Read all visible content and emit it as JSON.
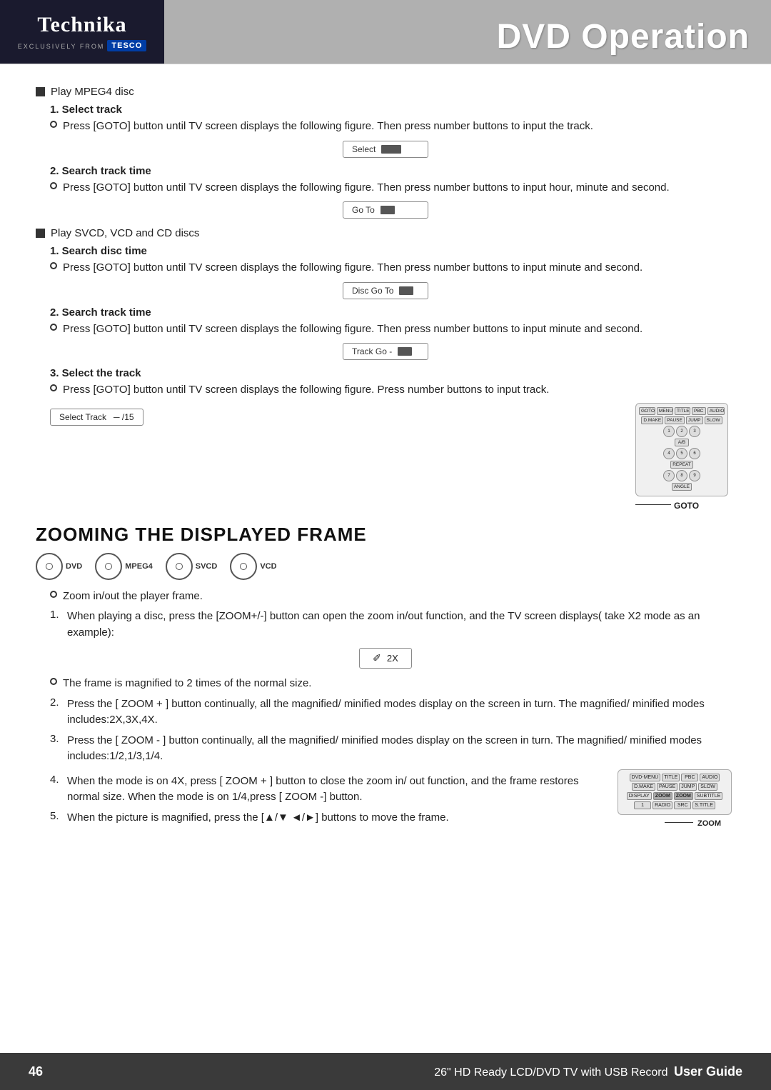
{
  "header": {
    "logo_main": "Technika",
    "logo_sub": "EXCLUSIVELY FROM",
    "tesco": "TESCO",
    "page_title": "DVD Operation"
  },
  "sections": {
    "play_mpeg4": "Play MPEG4 disc",
    "select_track": {
      "heading": "1. Select track",
      "bullet": "Press [GOTO] button until TV screen displays the following figure. Then press number buttons to input the track.",
      "mockup_label": "Select",
      "mockup_value": "■"
    },
    "search_track_time_1": {
      "heading": "2. Search track time",
      "bullet": "Press [GOTO] button until TV screen displays the following figure. Then press number buttons to input hour, minute and second.",
      "mockup_label": "Go To",
      "mockup_value": "──"
    },
    "play_svcd": "Play SVCD, VCD and CD discs",
    "search_disc_time": {
      "heading": "1. Search disc time",
      "bullet": "Press [GOTO] button until TV screen displays the following figure. Then press number buttons to input minute and second.",
      "mockup_label": "Disc Go To",
      "mockup_value": "──"
    },
    "search_track_time_2": {
      "heading": "2. Search track time",
      "bullet": "Press [GOTO] button until TV screen displays the following figure. Then press number buttons to input minute and second.",
      "mockup_label": "Track Go -",
      "mockup_value": "──"
    },
    "select_the_track": {
      "heading": "3. Select the track",
      "bullet": "Press [GOTO] button until TV screen displays the following figure. Press number buttons to input track.",
      "mockup_label": "Select Track",
      "mockup_value": "─ /15",
      "goto_label": "GOTO"
    }
  },
  "zooming": {
    "title": "ZOOMING THE DISPLAYED FRAME",
    "disc_labels": [
      "DVD",
      "MPEG4",
      "SVCD",
      "VCD"
    ],
    "bullet_zoom": "Zoom in/out the player frame.",
    "items": [
      {
        "num": "1.",
        "text": "When playing a disc, press the [ZOOM+/-] button can open the zoom in/out function, and the TV screen displays( take X2 mode as an example):"
      },
      {
        "num": "",
        "text": "The frame is magnified to 2 times of the normal size."
      },
      {
        "num": "2.",
        "text": "Press the [ ZOOM + ] button continually, all the magnified/ minified modes display on the screen in turn. The magnified/ minified modes includes:2X,3X,4X."
      },
      {
        "num": "3.",
        "text": "Press the [ ZOOM - ] button continually, all the magnified/ minified modes display on the screen in turn. The magnified/ minified modes includes:1/2,1/3,1/4."
      },
      {
        "num": "4.",
        "text": "When the mode is on 4X, press [ ZOOM + ] button to close the zoom in/ out function, and the frame restores normal size. When the mode is on 1/4,press [ ZOOM -] button."
      },
      {
        "num": "5.",
        "text": "When the picture is magnified, press the [▲/▼ ◄/►] buttons to move the frame."
      }
    ],
    "zoom_mockup_label": "✐",
    "zoom_mockup_value": "2X",
    "zoom_remote_label": "ZOOM"
  },
  "footer": {
    "page_number": "46",
    "description": "26\" HD Ready LCD/DVD TV with USB Record",
    "guide": "User Guide"
  },
  "remote_goto": {
    "rows": [
      [
        "GOTO",
        "MENU",
        "TITLE",
        "PBC",
        "AUDIO"
      ],
      [
        "D.MAKE",
        "PAUSE",
        "JUMP",
        "SLOW"
      ],
      [
        "1",
        "2",
        "3",
        ""
      ],
      [
        "A/B",
        ""
      ],
      [
        "4",
        "5",
        "6",
        ""
      ],
      [
        "REPEAT",
        ""
      ],
      [
        "7",
        "8",
        "9",
        ""
      ],
      [
        "ANGLE",
        ""
      ]
    ]
  },
  "remote_zoom": {
    "rows": [
      [
        "DVD-MENU",
        "TITLE",
        "PBC",
        "AUDIO"
      ],
      [
        "D.MAKE",
        "PAUSE",
        "JUMP",
        "SLOW"
      ],
      [
        "DISPLAY",
        "ZOOM",
        "ZOOM",
        "SUBTITLE"
      ],
      [
        "1",
        "RADIO",
        "SRC",
        "S.TITLE"
      ]
    ]
  }
}
